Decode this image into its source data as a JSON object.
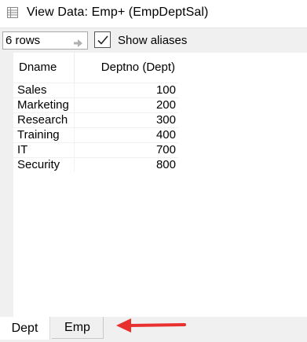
{
  "window": {
    "title": "View Data:  Emp+ (EmpDeptSal)",
    "icon": "table-icon"
  },
  "toolbar": {
    "rows_value": "6 rows",
    "go_icon": "arrow-right-icon",
    "show_aliases_checked": true,
    "show_aliases_label": "Show aliases"
  },
  "grid": {
    "columns": [
      "Dname",
      "Deptno (Dept)"
    ],
    "rows": [
      {
        "dname": "Sales",
        "deptno": "100"
      },
      {
        "dname": "Marketing",
        "deptno": "200"
      },
      {
        "dname": "Research",
        "deptno": "300"
      },
      {
        "dname": "Training",
        "deptno": "400"
      },
      {
        "dname": "IT",
        "deptno": "700"
      },
      {
        "dname": "Security",
        "deptno": "800"
      }
    ]
  },
  "tabs": [
    {
      "label": "Dept",
      "active": true
    },
    {
      "label": "Emp",
      "active": false
    }
  ],
  "annotation": {
    "icon": "red-arrow-icon",
    "color": "#e8312f"
  }
}
